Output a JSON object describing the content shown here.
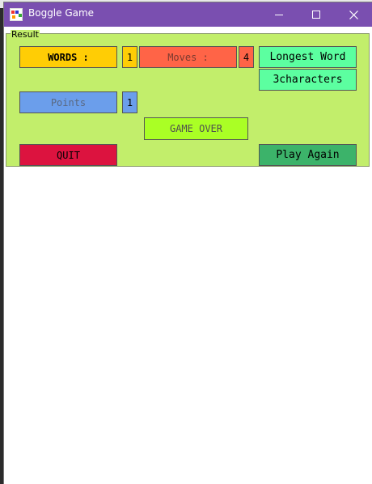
{
  "window": {
    "title": "Boggle Game",
    "accent_color": "#7a4fb0",
    "icon": "boggle-app-icon"
  },
  "controls": {
    "minimize_icon": "minimize-icon",
    "maximize_icon": "maximize-icon",
    "close_icon": "close-icon"
  },
  "result": {
    "group_label": "Result",
    "words_label": "WORDS :",
    "words_count": "1",
    "moves_label": "Moves :",
    "moves_count": "4",
    "longest_word_label": "Longest Word",
    "longest_word_value": "3characters",
    "points_label": "Points",
    "points_count": "1",
    "status": "GAME OVER",
    "quit_label": "QUIT",
    "play_again_label": "Play Again"
  },
  "colors": {
    "panel": "#c2ee6b",
    "words": "#ffcd05",
    "moves": "#ff6447",
    "longest": "#5cffa0",
    "points": "#6b9eeb",
    "game_over": "#aaff25",
    "quit": "#dc133f",
    "play_again": "#3cb36a"
  }
}
